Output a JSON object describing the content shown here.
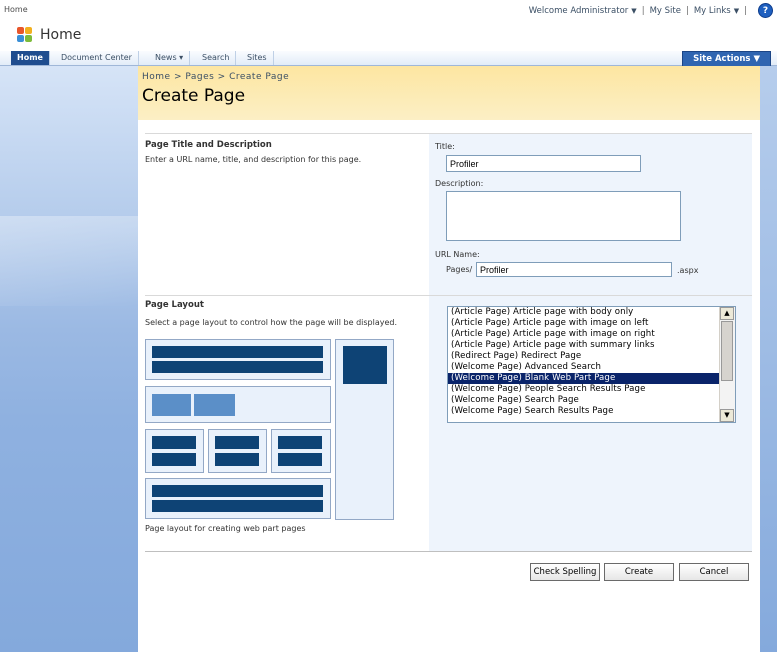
{
  "topbar": {
    "breadcrumb": "Home",
    "welcome": "Welcome Administrator",
    "my_site": "My Site",
    "my_links": "My Links",
    "sep": "|",
    "caret": "▼",
    "help_glyph": "?"
  },
  "header": {
    "site_title": "Home"
  },
  "tabs": [
    {
      "label": "Home"
    },
    {
      "label": "Document Center"
    },
    {
      "label": "News ▾"
    },
    {
      "label": "Search"
    },
    {
      "label": "Sites"
    }
  ],
  "site_actions": "Site Actions ▼",
  "page": {
    "breadcrumb": "Home > Pages > Create Page",
    "title": "Create Page"
  },
  "section1": {
    "title": "Page Title and Description",
    "desc": "Enter a URL name, title, and description for this page.",
    "title_label": "Title:",
    "title_value": "Profiler",
    "description_label": "Description:",
    "description_value": "",
    "url_label": "URL Name:",
    "url_prefix": "Pages/",
    "url_value": "Profiler",
    "url_suffix": ".aspx"
  },
  "section2": {
    "title": "Page Layout",
    "desc": "Select a page layout to control how the page will be displayed.",
    "preview_caption": "Page layout for creating web part pages",
    "options": [
      "(Article Page) Article page with body only",
      "(Article Page) Article page with image on left",
      "(Article Page) Article page with image on right",
      "(Article Page) Article page with summary links",
      "(Redirect Page) Redirect Page",
      "(Welcome Page) Advanced Search",
      "(Welcome Page) Blank Web Part Page",
      "(Welcome Page) People Search Results Page",
      "(Welcome Page) Search Page",
      "(Welcome Page) Search Results Page"
    ],
    "selected": "(Welcome Page) Blank Web Part Page",
    "scroll_up": "▲",
    "scroll_down": "▼"
  },
  "buttons": {
    "check_spelling": "Check Spelling",
    "create": "Create",
    "cancel": "Cancel"
  },
  "colors": {
    "tab_active": "#1f4d8f",
    "header_band": "#fde6a1",
    "selection": "#0a246a",
    "preview_bar": "#0e4375"
  }
}
